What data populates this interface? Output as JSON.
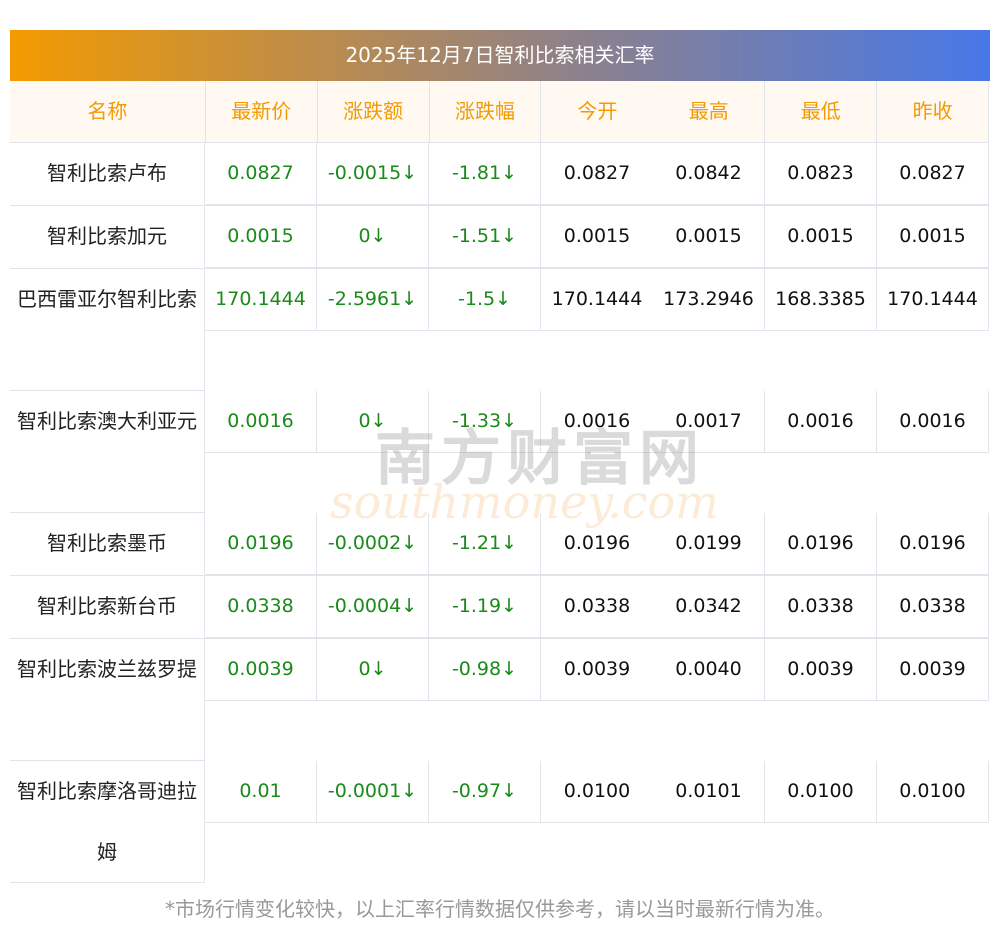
{
  "title": "2025年12月7日智利比索相关汇率",
  "headers": [
    "名称",
    "最新价",
    "涨跌额",
    "涨跌幅",
    "今开",
    "最高",
    "最低",
    "昨收"
  ],
  "rows": [
    {
      "name": "智利比索卢布",
      "tall": false,
      "v": [
        "0.0827",
        "-0.0015↓",
        "-1.81↓",
        "0.0827",
        "0.0842",
        "0.0823",
        "0.0827"
      ]
    },
    {
      "name": "智利比索加元",
      "tall": false,
      "v": [
        "0.0015",
        "0↓",
        "-1.51↓",
        "0.0015",
        "0.0015",
        "0.0015",
        "0.0015"
      ]
    },
    {
      "name": "巴西雷亚尔智利比索",
      "tall": true,
      "v": [
        "170.1444",
        "-2.5961↓",
        "-1.5↓",
        "170.1444",
        "173.2946",
        "168.3385",
        "170.1444"
      ]
    },
    {
      "name": "智利比索澳大利亚元",
      "tall": true,
      "v": [
        "0.0016",
        "0↓",
        "-1.33↓",
        "0.0016",
        "0.0017",
        "0.0016",
        "0.0016"
      ]
    },
    {
      "name": "智利比索墨币",
      "tall": false,
      "v": [
        "0.0196",
        "-0.0002↓",
        "-1.21↓",
        "0.0196",
        "0.0199",
        "0.0196",
        "0.0196"
      ]
    },
    {
      "name": "智利比索新台币",
      "tall": false,
      "v": [
        "0.0338",
        "-0.0004↓",
        "-1.19↓",
        "0.0338",
        "0.0342",
        "0.0338",
        "0.0338"
      ]
    },
    {
      "name": "智利比索波兰兹罗提",
      "tall": true,
      "v": [
        "0.0039",
        "0↓",
        "-0.98↓",
        "0.0039",
        "0.0040",
        "0.0039",
        "0.0039"
      ]
    },
    {
      "name": "智利比索摩洛哥迪拉姆",
      "tall": true,
      "v": [
        "0.01",
        "-0.0001↓",
        "-0.97↓",
        "0.0100",
        "0.0101",
        "0.0100",
        "0.0100"
      ]
    }
  ],
  "watermark": {
    "cn": "南方财富网",
    "en": "southmoney.com"
  },
  "footnote": "*市场行情变化较快，以上汇率行情数据仅供参考，请以当时最新行情为准。"
}
